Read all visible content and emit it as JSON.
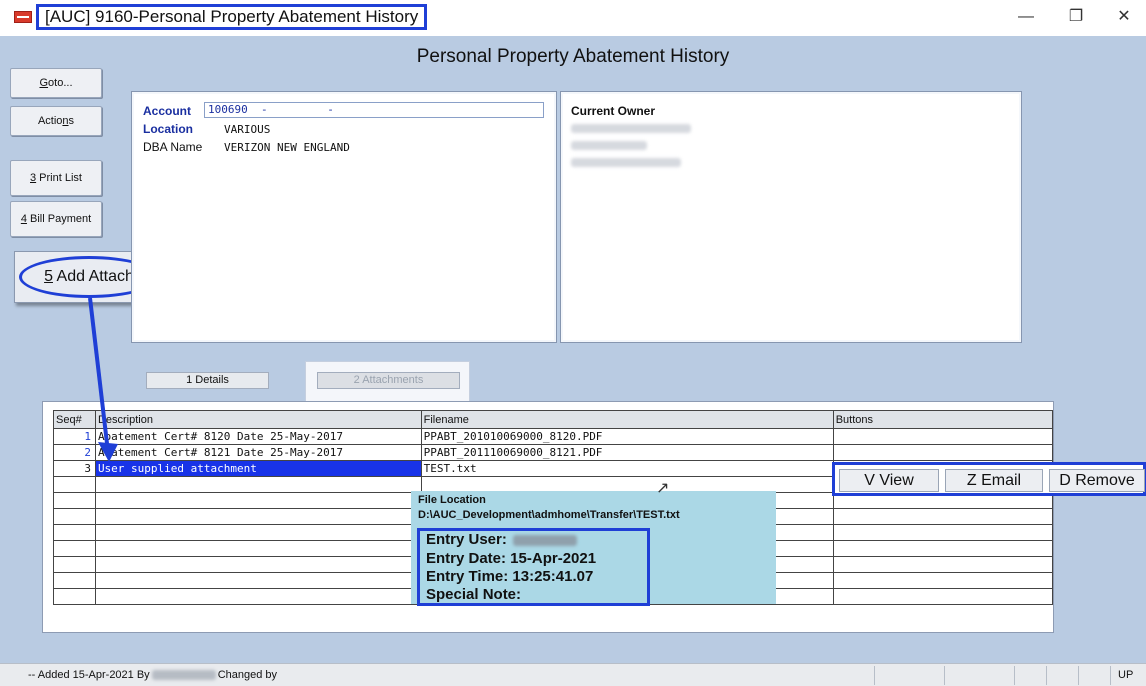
{
  "window": {
    "title": "[AUC] 9160-Personal Property Abatement History",
    "controls": [
      "—",
      "❐",
      "✕"
    ]
  },
  "page": {
    "heading": "Personal Property Abatement History"
  },
  "sidebar": {
    "goto_prefix": "G",
    "goto_rest": "oto...",
    "actions_prefix": "Actio",
    "actions_under": "n",
    "actions_rest": "s",
    "print_list_num": "3",
    "print_list_rest": " Print List",
    "bill_payment_num": "4",
    "bill_payment_rest": " Bill Payment",
    "add_attach_num": "5",
    "add_attach_rest": " Add Attach"
  },
  "account_panel": {
    "account_label": "Account",
    "account_value": "100690  -         -",
    "location_label": "Location",
    "location_value": "VARIOUS",
    "dba_label": "DBA Name",
    "dba_value": "VERIZON NEW ENGLAND"
  },
  "owner_panel": {
    "title": "Current Owner"
  },
  "tabs": [
    {
      "label": "1 Details",
      "active": true
    },
    {
      "label": "2 Attachments",
      "active": false
    }
  ],
  "grid": {
    "columns": [
      "Seq#",
      "Description",
      "Filename",
      "Buttons"
    ],
    "rows": [
      {
        "seq": "1",
        "description": "Abatement Cert# 8120 Date 25-May-2017",
        "filename": "PPABT_201010069000_8120.PDF"
      },
      {
        "seq": "2",
        "description": "Abatement Cert# 8121 Date 25-May-2017",
        "filename": "PPABT_201110069000_8121.PDF"
      },
      {
        "seq": "3",
        "description": "User supplied attachment",
        "filename": "TEST.txt"
      }
    ]
  },
  "row_buttons": {
    "view": "V View",
    "email": "Z Email",
    "remove": "D Remove"
  },
  "tooltip": {
    "heading": "File Location",
    "path": "D:\\AUC_Development\\admhome\\Transfer\\TEST.txt",
    "entry_user_label": "Entry User:",
    "entry_date": "Entry Date: 15-Apr-2021",
    "entry_time": "Entry Time: 13:25:41.07",
    "special_note": "Special Note:"
  },
  "status": {
    "added": "-- Added 15-Apr-2021 By",
    "changed": "Changed  by",
    "mode": "UP"
  },
  "colors": {
    "accent": "#1f3fd6",
    "background": "#b9cbe2",
    "selection": "#1833e8",
    "tooltip": "#abd8e6"
  }
}
